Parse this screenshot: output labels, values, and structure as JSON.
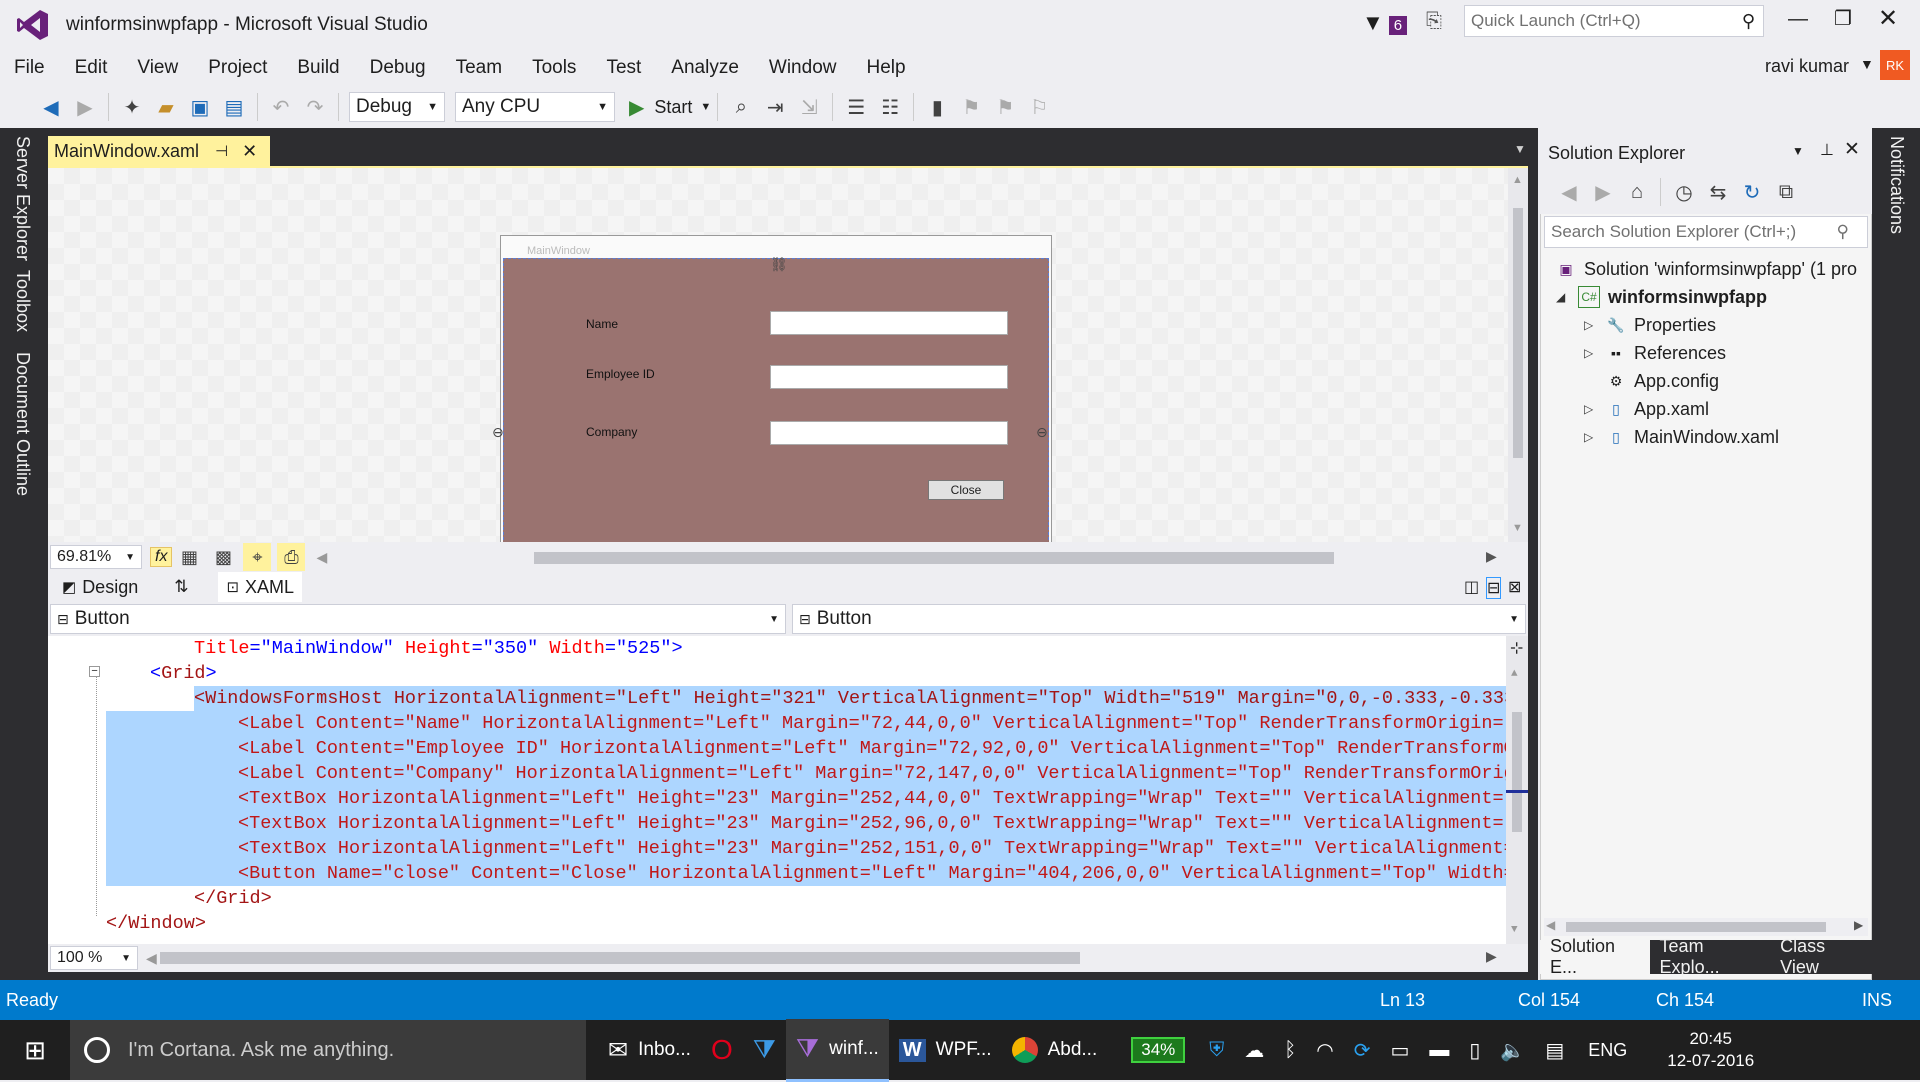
{
  "title_bar": {
    "app_title": "winformsinwpfapp - Microsoft Visual Studio",
    "notification_count": "6",
    "quick_launch_placeholder": "Quick Launch (Ctrl+Q)",
    "user_name": "ravi kumar",
    "user_initials": "RK"
  },
  "menu": [
    "File",
    "Edit",
    "View",
    "Project",
    "Build",
    "Debug",
    "Team",
    "Tools",
    "Test",
    "Analyze",
    "Window",
    "Help"
  ],
  "toolbar": {
    "config": "Debug",
    "platform": "Any CPU",
    "start_label": "Start"
  },
  "left_rail": [
    "Server Explorer",
    "Toolbox",
    "Document Outline"
  ],
  "right_rail": [
    "Notifications"
  ],
  "document_tab": {
    "name": "MainWindow.xaml"
  },
  "designer": {
    "window_title": "MainWindow",
    "labels": [
      "Name",
      "Employee ID",
      "Company"
    ],
    "close_button": "Close",
    "zoom": "69.81%",
    "fx_label": "fx"
  },
  "panel_tabs": {
    "design": "Design",
    "xaml": "XAML"
  },
  "navbar": {
    "left": "Button",
    "right": "Button"
  },
  "code": {
    "line1": {
      "a1": "Title",
      "v1": "\"MainWindow\"",
      "a2": "Height",
      "v2": "\"350\"",
      "a3": "Width",
      "v3": "\"525\""
    },
    "line2_tag": "Grid",
    "line3": "<WindowsFormsHost HorizontalAlignment=\"Left\" Height=\"321\" VerticalAlignment=\"Top\" Width=\"519\" Margin=\"0,0,-0.333,-0.333",
    "line4": "<Label Content=\"Name\" HorizontalAlignment=\"Left\" Margin=\"72,44,0,0\" VerticalAlignment=\"Top\" RenderTransformOrigin=\"",
    "line5": "<Label Content=\"Employee ID\" HorizontalAlignment=\"Left\" Margin=\"72,92,0,0\" VerticalAlignment=\"Top\" RenderTransformO",
    "line6": "<Label Content=\"Company\" HorizontalAlignment=\"Left\" Margin=\"72,147,0,0\" VerticalAlignment=\"Top\" RenderTransformOrig",
    "line7": "<TextBox HorizontalAlignment=\"Left\" Height=\"23\" Margin=\"252,44,0,0\" TextWrapping=\"Wrap\" Text=\"\" VerticalAlignment=\"",
    "line8": "<TextBox HorizontalAlignment=\"Left\" Height=\"23\" Margin=\"252,96,0,0\" TextWrapping=\"Wrap\" Text=\"\" VerticalAlignment=\"",
    "line9": "<TextBox HorizontalAlignment=\"Left\" Height=\"23\" Margin=\"252,151,0,0\" TextWrapping=\"Wrap\" Text=\"\" VerticalAlignment=",
    "line10": "<Button Name=\"close\" Content=\"Close\" HorizontalAlignment=\"Left\" Margin=\"404,206,0,0\" VerticalAlignment=\"Top\" Width=",
    "line11": "</Grid>",
    "line12": "</Window>",
    "zoom": "100 %"
  },
  "solution_explorer": {
    "title": "Solution Explorer",
    "search_placeholder": "Search Solution Explorer (Ctrl+;)",
    "solution": "Solution 'winformsinwpfapp' (1 pro",
    "project": "winformsinwpfapp",
    "items": [
      "Properties",
      "References",
      "App.config",
      "App.xaml",
      "MainWindow.xaml"
    ],
    "tabs": [
      "Solution E...",
      "Team Explo...",
      "Class View"
    ]
  },
  "status": {
    "ready": "Ready",
    "ln": "Ln 13",
    "col": "Col 154",
    "ch": "Ch 154",
    "mode": "INS"
  },
  "taskbar": {
    "cortana": "I'm Cortana. Ask me anything.",
    "apps": [
      "Inbo...",
      "",
      "",
      "winf...",
      "WPF...",
      "Abd..."
    ],
    "battery": "34%",
    "lang": "ENG",
    "time": "20:45",
    "date": "12-07-2016"
  },
  "colors": {
    "accent": "#007acc",
    "tab_active": "#fff29d",
    "designer_bg": "#9a7370",
    "selection": "#add6ff"
  }
}
